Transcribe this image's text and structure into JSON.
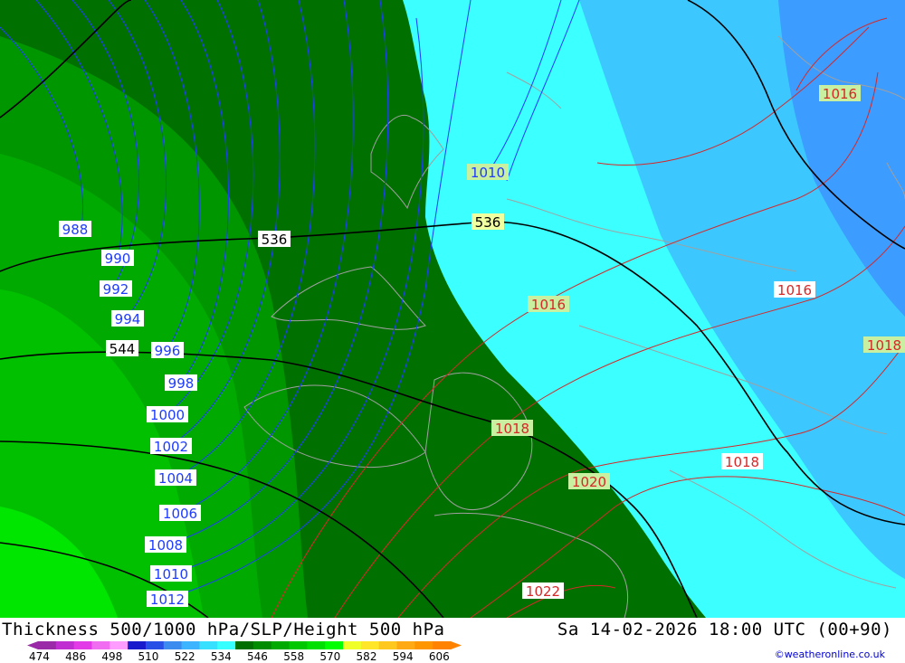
{
  "map": {
    "title": "Thickness 500/1000 hPa/SLP/Height 500 hPa",
    "valid_time": "Sa 14-02-2026 18:00 UTC (00+90)",
    "credit": "©weatheronline.co.uk",
    "slp_labels_blue": [
      "988",
      "990",
      "992",
      "994",
      "996",
      "998",
      "1000",
      "1002",
      "1004",
      "1006",
      "1008",
      "1010",
      "1012",
      "1010"
    ],
    "slp_labels_red": [
      "1016",
      "1016",
      "1016",
      "1018",
      "1018",
      "1018",
      "1020",
      "1022"
    ],
    "height_labels": [
      "536",
      "536",
      "544"
    ],
    "colorbar": {
      "ticks": [
        "474",
        "486",
        "498",
        "510",
        "522",
        "534",
        "546",
        "558",
        "570",
        "582",
        "594",
        "606"
      ],
      "colors": [
        "#9b2aa8",
        "#c02dd0",
        "#e23ae6",
        "#f06cf0",
        "#ff9cff",
        "#1a1acd",
        "#2850e6",
        "#3c8cf0",
        "#3cb4ff",
        "#38e0ff",
        "#38ffff",
        "#006e00",
        "#008c00",
        "#00aa00",
        "#00c800",
        "#00e000",
        "#00ff00",
        "#f0ff28",
        "#ffe628",
        "#ffc81e",
        "#ffaa14",
        "#ff9600",
        "#ff8200"
      ]
    },
    "colors": {
      "green_dark": "#007000",
      "green_mid": "#009600",
      "green_light": "#00d600",
      "cyan": "#3cffff",
      "light_blue": "#3cc8ff",
      "blue": "#3c9cff",
      "isobar_blue": "#1e3cff",
      "isobar_red": "#d72828",
      "height_black": "#000000"
    }
  }
}
